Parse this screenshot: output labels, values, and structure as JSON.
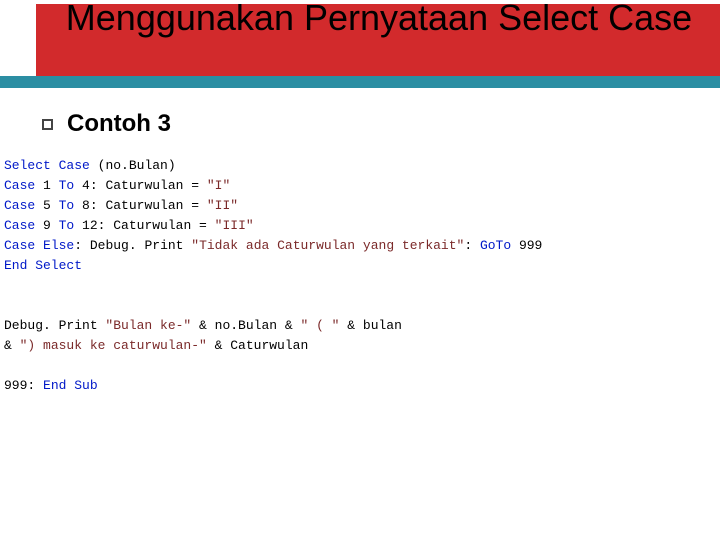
{
  "title": "Menggunakan Pernyataan Select Case",
  "subtitle": "Contoh 3",
  "code": {
    "kw_select_case": "Select Case",
    "no_bulan_paren": "(no.Bulan)",
    "kw_case": "Case",
    "range1": " 1 ",
    "kw_to": "To",
    "range1b": " 4: Caturwulan = ",
    "str_I": "\"I\"",
    "range2": " 5 ",
    "range2b": " 8: Caturwulan = ",
    "str_II": "\"II\"",
    "range3": " 9 ",
    "range3b": " 12: Caturwulan = ",
    "str_III": "\"III\"",
    "kw_else": "Else",
    "else_colon": ": Debug. Print ",
    "str_tidak": "\"Tidak ada Caturwulan yang terkait\"",
    "colon_space": ": ",
    "kw_goto": "GoTo",
    "goto_num": " 999",
    "kw_end_select": "End Select",
    "debug_print": "Debug. Print ",
    "str_bulan_ke": "\"Bulan ke-\"",
    "amp1": " & no.Bulan & ",
    "str_open_paren": "\" ( \"",
    "amp2": " & bulan",
    "amp3": "& ",
    "str_close_paren": "\") masuk ke caturwulan-\"",
    "amp4": " & Caturwulan",
    "label_999": "999: ",
    "kw_end_sub": "End Sub"
  }
}
